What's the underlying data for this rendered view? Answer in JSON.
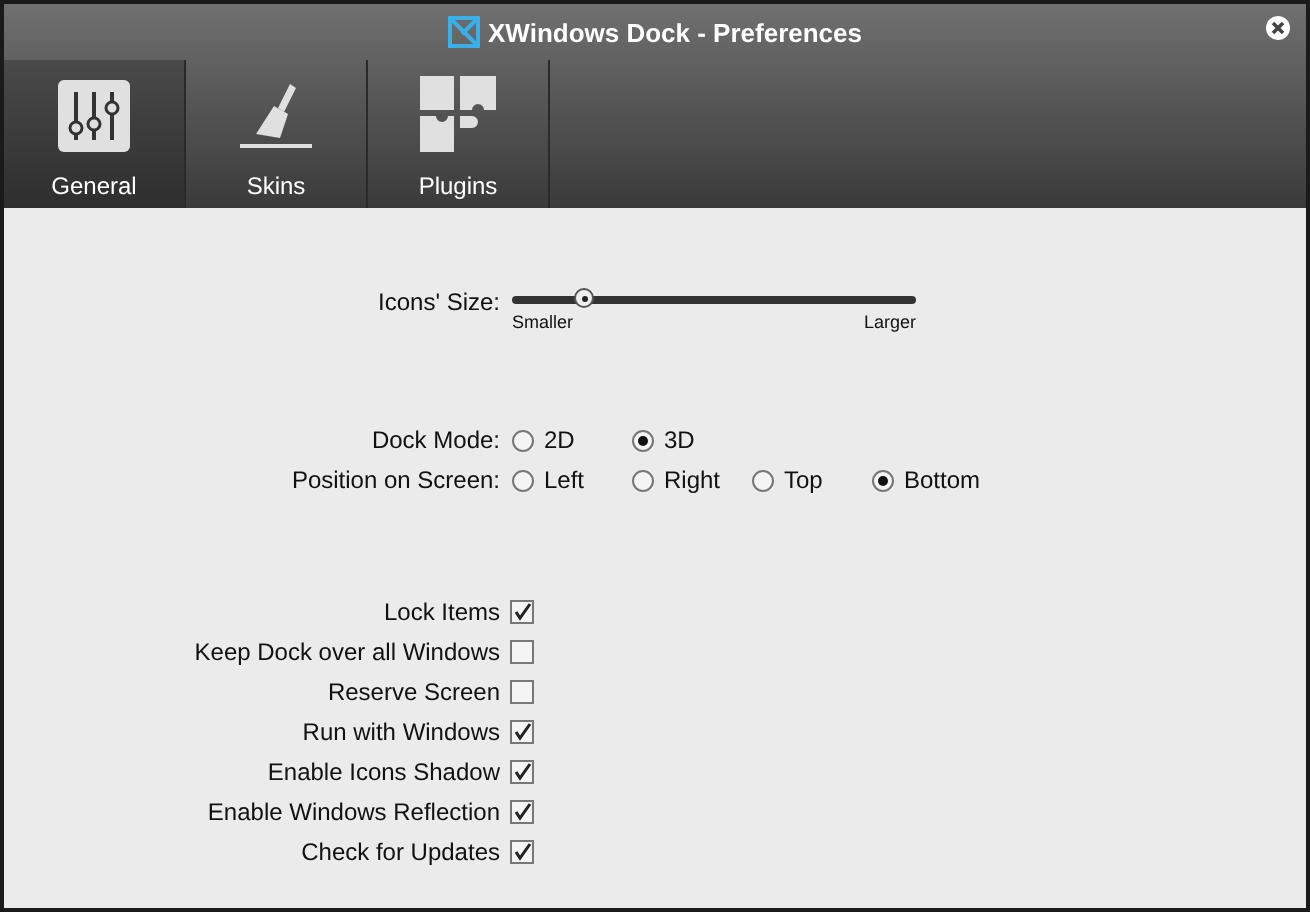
{
  "window": {
    "title": "XWindows Dock - Preferences"
  },
  "tabs": [
    {
      "label": "General",
      "kind": "sliders",
      "selected": true
    },
    {
      "label": "Skins",
      "kind": "brush",
      "selected": false
    },
    {
      "label": "Plugins",
      "kind": "puzzle",
      "selected": false
    }
  ],
  "icons_size": {
    "label": "Icons' Size:",
    "level": 0.18,
    "min_label": "Smaller",
    "max_label": "Larger"
  },
  "radio_groups": [
    {
      "label": "Dock Mode:",
      "options": [
        {
          "label": "2D",
          "selected": false
        },
        {
          "label": "3D",
          "selected": true
        }
      ]
    },
    {
      "label": "Position on Screen:",
      "options": [
        {
          "label": "Left",
          "selected": false
        },
        {
          "label": "Right",
          "selected": false
        },
        {
          "label": "Top",
          "selected": false
        },
        {
          "label": "Bottom",
          "selected": true
        }
      ]
    }
  ],
  "options": [
    {
      "label": "Lock Items",
      "checked": true
    },
    {
      "label": "Keep Dock over all Windows",
      "checked": false
    },
    {
      "label": "Reserve Screen",
      "checked": false
    },
    {
      "label": "Run with Windows",
      "checked": true
    },
    {
      "label": "Enable Icons Shadow",
      "checked": true
    },
    {
      "label": "Enable Windows Reflection",
      "checked": true
    },
    {
      "label": "Check for Updates",
      "checked": true
    }
  ]
}
